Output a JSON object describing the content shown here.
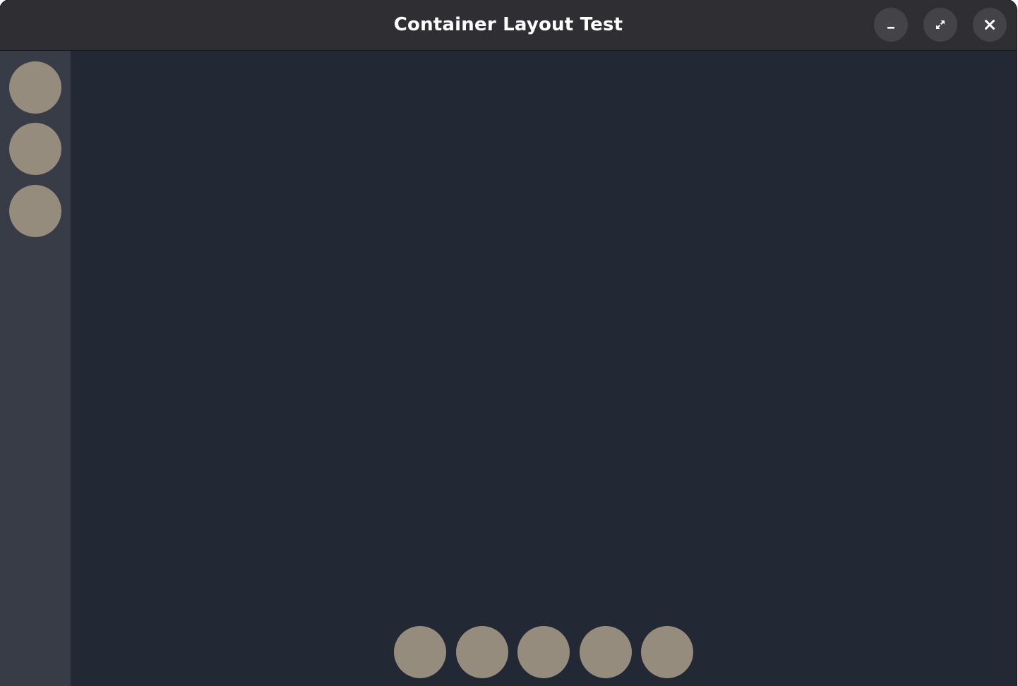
{
  "window": {
    "title": "Container Layout Test",
    "controls": {
      "minimize_icon": "minimize-icon",
      "maximize_icon": "maximize-icon",
      "close_icon": "close-icon"
    }
  },
  "colors": {
    "titlebar": "#2e2e33",
    "window_button": "#434348",
    "sidebar": "#373c47",
    "content": "#222834",
    "circle": "#968c7e",
    "title_text": "#ffffff"
  },
  "sidebar": {
    "items": [
      {
        "name": "circle-1"
      },
      {
        "name": "circle-2"
      },
      {
        "name": "circle-3"
      }
    ]
  },
  "bottom_bar": {
    "items": [
      {
        "name": "circle-1"
      },
      {
        "name": "circle-2"
      },
      {
        "name": "circle-3"
      },
      {
        "name": "circle-4"
      },
      {
        "name": "circle-5"
      }
    ]
  }
}
